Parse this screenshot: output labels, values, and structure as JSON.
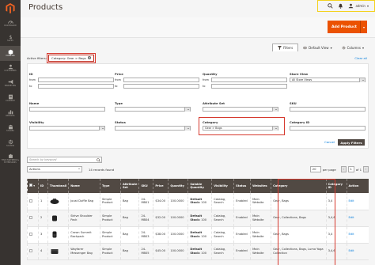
{
  "sidebar": {
    "items": [
      {
        "label": "DASHBOARD",
        "icon": "dashboard-icon"
      },
      {
        "label": "SALES",
        "icon": "dollar-icon"
      },
      {
        "label": "CATALOG",
        "icon": "catalog-box-icon"
      },
      {
        "label": "CUSTOMERS",
        "icon": "customers-icon"
      },
      {
        "label": "MARKETING",
        "icon": "megaphone-icon"
      },
      {
        "label": "CONTENT",
        "icon": "content-icon"
      },
      {
        "label": "REPORTS",
        "icon": "bar-chart-icon"
      },
      {
        "label": "STORES",
        "icon": "store-icon"
      },
      {
        "label": "SYSTEM",
        "icon": "gear-icon"
      },
      {
        "label": "FIND PARTNERS & EXTENSIONS",
        "icon": "puzzle-icon"
      }
    ]
  },
  "header": {
    "title": "Products",
    "user": "admin",
    "add_product": "Add Product"
  },
  "toolbar": {
    "filters": "Filters",
    "view": "Default View",
    "columns": "Columns"
  },
  "active_filters": {
    "label": "Active filters:",
    "chip": "Category: Gear > Bags",
    "clear_all": "Clear all"
  },
  "filters": {
    "id": {
      "label": "ID",
      "from": "from",
      "to": "to"
    },
    "price": {
      "label": "Price",
      "from": "from",
      "to": "to"
    },
    "quantity": {
      "label": "Quantity",
      "from": "from",
      "to": "to"
    },
    "store_view": {
      "label": "Store View",
      "value": "All Store Views"
    },
    "name": {
      "label": "Name"
    },
    "type": {
      "label": "Type"
    },
    "attribute_set": {
      "label": "Attribute Set"
    },
    "sku": {
      "label": "SKU"
    },
    "visibility": {
      "label": "Visibility"
    },
    "status": {
      "label": "Status"
    },
    "category": {
      "label": "Category",
      "value": "Gear > Bags"
    },
    "category_id": {
      "label": "Category ID"
    },
    "cancel": "Cancel",
    "apply": "Apply Filters"
  },
  "search": {
    "placeholder": "Search by keyword"
  },
  "actions": {
    "label": "Actions"
  },
  "records": "14 records found",
  "pager": {
    "per_page": "20",
    "page": "1",
    "of": "of 1"
  },
  "grid": {
    "columns": [
      "ID",
      "Thumbnail",
      "Name",
      "Type",
      "Attribute Set",
      "SKU",
      "Price",
      "Quantity",
      "Salable Quantity",
      "Visibility",
      "Status",
      "Websites",
      "Category",
      "Category ID",
      "Action"
    ],
    "rows": [
      {
        "id": "1",
        "name": "Joust Duffle Bag",
        "type": "Simple Product",
        "attr": "Bag",
        "sku": "24-MB01",
        "price": "$34.00",
        "qty": "100.0000",
        "salable_label": "Default Stock:",
        "salable_val": "100",
        "visibility": "Catalog, Search",
        "status": "Enabled",
        "websites": "Main Website",
        "category": "Gear, Bags",
        "category_id": "3,4",
        "action": "Edit"
      },
      {
        "id": "2",
        "name": "Strive Shoulder Pack",
        "type": "Simple Product",
        "attr": "Bag",
        "sku": "24-MB04",
        "price": "$32.00",
        "qty": "100.0000",
        "salable_label": "Default Stock:",
        "salable_val": "100",
        "visibility": "Catalog, Search",
        "status": "Enabled",
        "websites": "Main Website",
        "category": "Gear, Collections, Bags",
        "category_id": "3,4,6",
        "action": "Edit"
      },
      {
        "id": "3",
        "name": "Crown Summit Backpack",
        "type": "Simple Product",
        "attr": "Bag",
        "sku": "24-MB03",
        "price": "$38.00",
        "qty": "100.0000",
        "salable_label": "Default Stock:",
        "salable_val": "100",
        "visibility": "Catalog, Search",
        "status": "Enabled",
        "websites": "Main Website",
        "category": "Gear, Bags",
        "category_id": "3,4",
        "action": "Edit"
      },
      {
        "id": "4",
        "name": "Wayfarer Messenger Bag",
        "type": "Simple Product",
        "attr": "Bag",
        "sku": "24-MB05",
        "price": "$45.00",
        "qty": "100.0000",
        "salable_label": "Default Stock:",
        "salable_val": "100",
        "visibility": "Catalog, Search",
        "status": "Enabled",
        "websites": "Main Website",
        "category": "Gear, Collections, Bags, Luma Yoga Collection",
        "category_id": "3,4,6",
        "action": "Edit"
      }
    ]
  },
  "colors": {
    "sidebar": "#373330",
    "accent": "#eb5202",
    "highlight": "#d6392e",
    "grid_header": "#514943"
  }
}
